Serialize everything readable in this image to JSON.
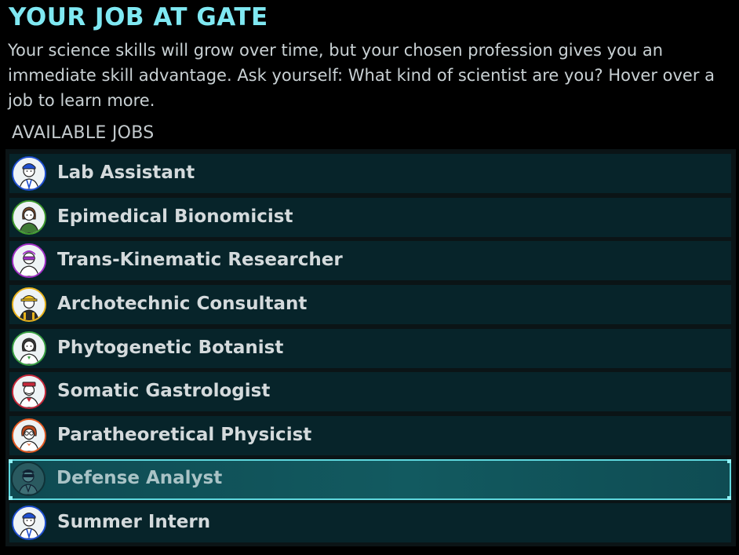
{
  "header": {
    "title": "YOUR JOB AT GATE",
    "description": "Your science skills will grow over time, but your chosen profession gives you an immediate skill advantage. Ask yourself: What kind of scientist are you? Hover over a job to learn more."
  },
  "jobs_section": {
    "label": "AVAILABLE JOBS",
    "jobs": [
      {
        "label": "Lab Assistant",
        "ring_color": "#1f4fd0",
        "icon": "lab-assistant-avatar-icon"
      },
      {
        "label": "Epimedical Bionomicist",
        "ring_color": "#3f9a2e",
        "icon": "epimedical-bionomicist-avatar-icon"
      },
      {
        "label": "Trans-Kinematic Researcher",
        "ring_color": "#a12fc6",
        "icon": "trans-kinematic-researcher-avatar-icon"
      },
      {
        "label": "Archotechnic Consultant",
        "ring_color": "#e8b21b",
        "icon": "archotechnic-consultant-avatar-icon"
      },
      {
        "label": "Phytogenetic Botanist",
        "ring_color": "#3aa043",
        "icon": "phytogenetic-botanist-avatar-icon"
      },
      {
        "label": "Somatic Gastrologist",
        "ring_color": "#c6283a",
        "icon": "somatic-gastrologist-avatar-icon"
      },
      {
        "label": "Paratheoretical Physicist",
        "ring_color": "#e25a23",
        "icon": "paratheoretical-physicist-avatar-icon"
      },
      {
        "label": "Defense Analyst",
        "ring_color": "#0f3238",
        "icon": "defense-analyst-avatar-icon",
        "selected": true
      },
      {
        "label": "Summer Intern",
        "ring_color": "#1f4fd0",
        "icon": "summer-intern-avatar-icon"
      }
    ]
  },
  "colors": {
    "title": "#7fe8f2",
    "row_bg": "#07242a",
    "selected_border": "#5fd8de"
  }
}
